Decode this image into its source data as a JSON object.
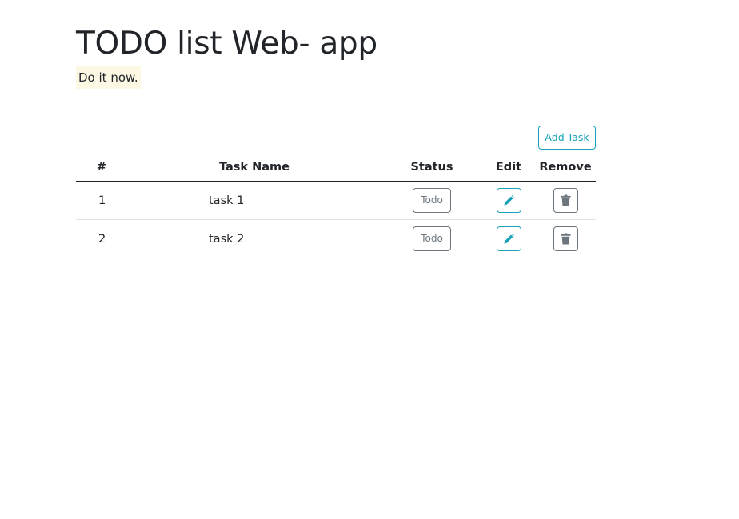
{
  "header": {
    "title": "TODO list Web- app",
    "subtitle": "Do it now."
  },
  "toolbar": {
    "add_task_label": "Add Task"
  },
  "table": {
    "columns": [
      "#",
      "Task Name",
      "Status",
      "Edit",
      "Remove"
    ],
    "rows": [
      {
        "num": "1",
        "name": "task 1",
        "status": "Todo"
      },
      {
        "num": "2",
        "name": "task 2",
        "status": "Todo"
      }
    ]
  },
  "icons": {
    "edit": "pencil-icon",
    "remove": "trash-icon"
  },
  "colors": {
    "accent": "#17a2b8",
    "secondary": "#6c757d",
    "highlight": "#fcf8e3",
    "text": "#212529"
  }
}
